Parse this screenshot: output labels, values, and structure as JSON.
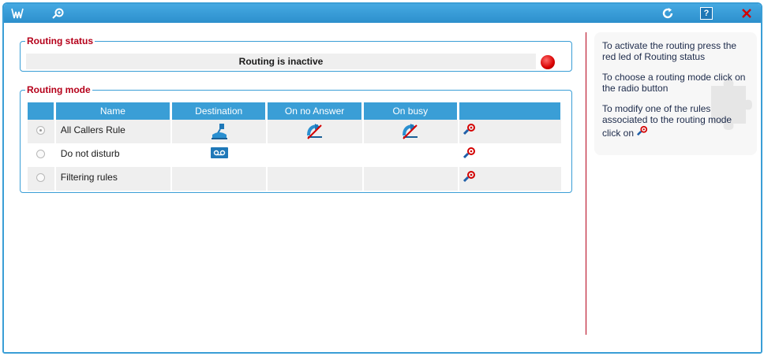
{
  "window": {
    "help_label": "?",
    "icons": {
      "app": "app-logo-icon",
      "gear": "gear-icon",
      "refresh": "refresh-icon",
      "close": "close-icon"
    }
  },
  "routing_status": {
    "legend": "Routing status",
    "text": "Routing is inactive",
    "led_color": "#d80000"
  },
  "routing_mode": {
    "legend": "Routing mode",
    "columns": [
      "Name",
      "Destination",
      "On no Answer",
      "On busy"
    ],
    "rows": [
      {
        "name": "All Callers Rule",
        "selected": true,
        "destination": "forward-icon",
        "on_no_answer": "forward-disabled-icon",
        "on_busy": "forward-disabled-icon"
      },
      {
        "name": "Do not disturb",
        "selected": false,
        "destination": "voicemail-icon",
        "on_no_answer": "",
        "on_busy": ""
      },
      {
        "name": "Filtering rules",
        "selected": false,
        "destination": "",
        "on_no_answer": "",
        "on_busy": ""
      }
    ]
  },
  "help": {
    "line1": "To activate the routing press the red led of Routing status",
    "line2": "To choose a routing mode click on the radio button",
    "line3": "To modify one of the rules associated to the routing mode click on"
  },
  "colors": {
    "accent": "#3a9ed6",
    "legend": "#b5001a",
    "status_bg": "#efefef"
  }
}
